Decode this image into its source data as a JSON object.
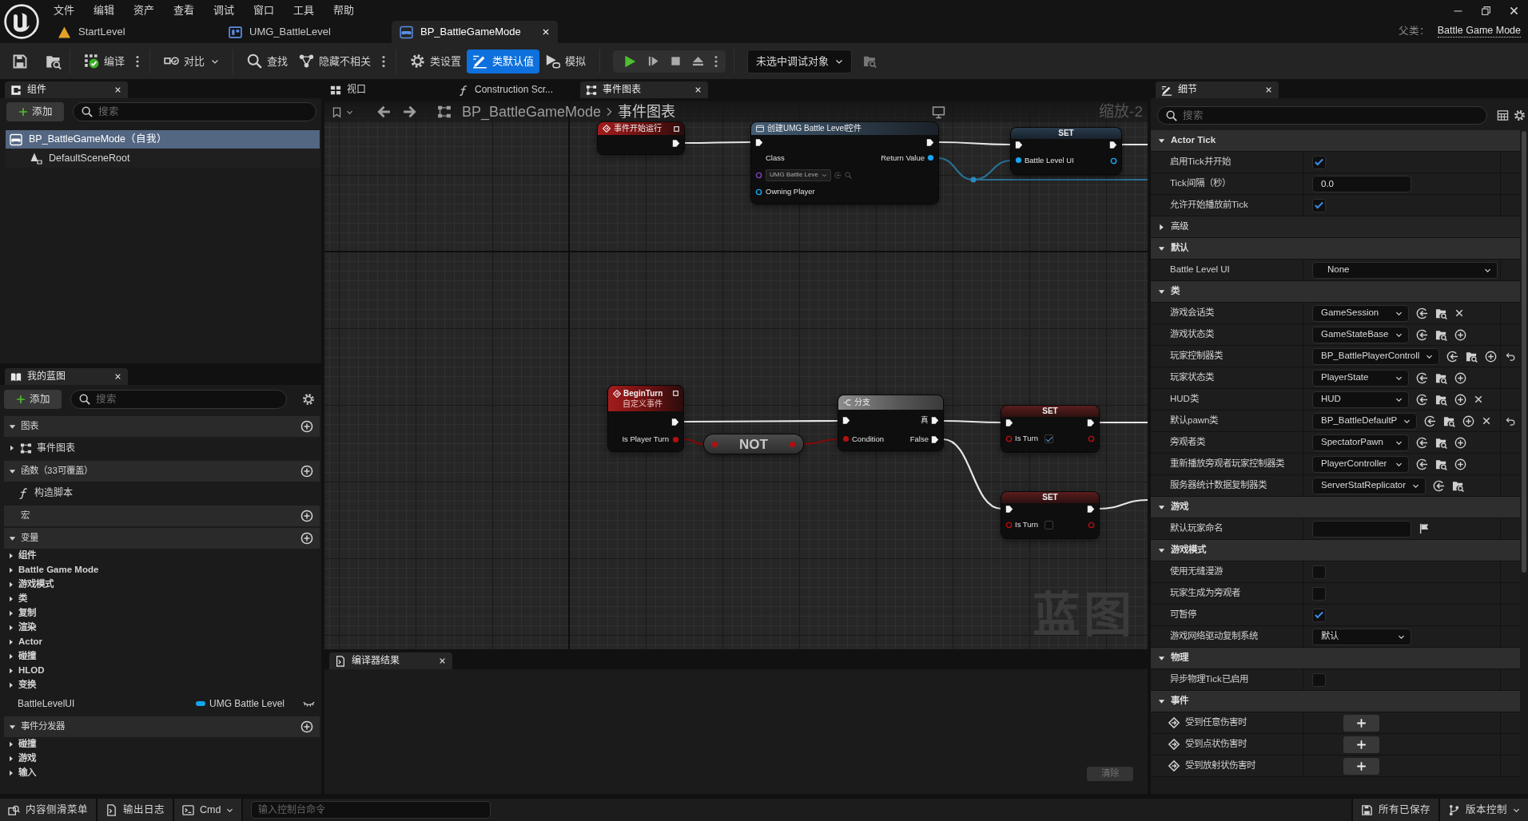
{
  "menu": [
    "文件",
    "编辑",
    "资产",
    "查看",
    "调试",
    "窗口",
    "工具",
    "帮助"
  ],
  "doc_tabs": [
    {
      "label": "StartLevel",
      "kind": "level",
      "selected": false
    },
    {
      "label": "UMG_BattleLevel",
      "kind": "widget",
      "selected": false
    },
    {
      "label": "BP_BattleGameMode",
      "kind": "blueprint",
      "selected": true
    }
  ],
  "parent_class": {
    "label": "父类：",
    "value": "Battle Game Mode"
  },
  "toolbar": {
    "buttons": [
      {
        "kind": "compile",
        "label": "编译",
        "selected": false
      },
      {
        "kind": "diff",
        "label": "对比",
        "selected": false
      },
      {
        "kind": "find",
        "label": "查找",
        "selected": false
      },
      {
        "kind": "hide_unrelated",
        "label": "隐藏不相关",
        "selected": false
      },
      {
        "kind": "class_settings",
        "label": "类设置",
        "selected": false
      },
      {
        "kind": "class_defaults",
        "label": "类默认值",
        "selected": true
      },
      {
        "kind": "simulate",
        "label": "模拟",
        "selected": false
      }
    ],
    "debug_target": "未选中调试对象"
  },
  "components": {
    "tab": "组件",
    "add_button": "添加",
    "search_placeholder": "搜索",
    "tree": [
      {
        "label": "BP_BattleGameMode（自我）",
        "selected": true,
        "children": [
          {
            "label": "DefaultSceneRoot",
            "selected": false
          }
        ]
      }
    ]
  },
  "my_blueprint": {
    "tab": "我的蓝图",
    "add_button": "添加",
    "search_placeholder": "搜索",
    "sections": [
      {
        "title": "图表",
        "expanded": true,
        "items": [
          {
            "kind": "graph",
            "label": "事件图表",
            "expanded": false
          }
        ]
      },
      {
        "title": "函数（33可覆盖）",
        "expanded": true,
        "items": [
          {
            "kind": "function",
            "label": "构造脚本"
          }
        ]
      },
      {
        "title": "宏",
        "expanded": false
      },
      {
        "title": "变量",
        "expanded": true,
        "items": [
          {
            "kind": "category",
            "label": "组件",
            "expanded": false
          },
          {
            "kind": "category",
            "label": "Battle Game Mode",
            "expanded": false
          },
          {
            "kind": "category",
            "label": "游戏模式",
            "expanded": false
          },
          {
            "kind": "category",
            "label": "类",
            "expanded": false
          },
          {
            "kind": "category",
            "label": "复制",
            "expanded": false
          },
          {
            "kind": "category",
            "label": "渲染",
            "expanded": false
          },
          {
            "kind": "category",
            "label": "Actor",
            "expanded": false
          },
          {
            "kind": "category",
            "label": "碰撞",
            "expanded": false
          },
          {
            "kind": "category",
            "label": "HLOD",
            "expanded": false
          },
          {
            "kind": "category",
            "label": "变换",
            "expanded": false
          },
          {
            "kind": "variable",
            "label": "BattleLevelUI",
            "type": "UMG Battle Level"
          }
        ]
      },
      {
        "title": "事件分发器",
        "expanded": true,
        "items": [
          {
            "kind": "category",
            "label": "碰撞",
            "expanded": false
          },
          {
            "kind": "category",
            "label": "游戏",
            "expanded": false
          },
          {
            "kind": "category",
            "label": "输入",
            "expanded": false
          }
        ]
      }
    ]
  },
  "graph": {
    "tabs": [
      {
        "kind": "viewport",
        "label": "视口",
        "selected": false
      },
      {
        "kind": "function",
        "label": "Construction Scr...",
        "selected": false
      },
      {
        "kind": "graph",
        "label": "事件图表",
        "selected": true
      }
    ],
    "breadcrumb": [
      "BP_BattleGameMode",
      "事件图表"
    ],
    "zoom_label": "缩放-2",
    "corner_label": "蓝图",
    "nodes": [
      {
        "kind": "event",
        "title": "事件开始运行"
      },
      {
        "kind": "call",
        "title": "创建UMG Battle Level控件",
        "inputs": [
          {
            "label": "Class",
            "value": "UMG Battle Leve"
          },
          {
            "label": "Owning Player"
          }
        ],
        "output": "Return Value"
      },
      {
        "kind": "set_object",
        "title": "SET",
        "pin": "Battle Level UI"
      },
      {
        "kind": "custom_event",
        "title": "BeginTurn",
        "subtitle": "自定义事件",
        "pin": "Is Player Turn"
      },
      {
        "kind": "not",
        "title": "NOT"
      },
      {
        "kind": "branch",
        "title": "分支",
        "true_label": "真",
        "condition": "Condition",
        "false_label": "False"
      },
      {
        "kind": "set_bool",
        "title": "SET",
        "pin": "Is Turn",
        "checked": true
      },
      {
        "kind": "set_bool",
        "title": "SET",
        "pin": "Is Turn",
        "checked": false
      }
    ]
  },
  "compiler_results": {
    "tab": "编译器结果",
    "clear_button": {
      "label": "清除",
      "disabled": true
    }
  },
  "details": {
    "tab": "细节",
    "search_placeholder": "搜索",
    "sections": [
      {
        "title": "Actor Tick",
        "expanded": true,
        "rows": [
          {
            "kind": "checkbox",
            "label": "启用Tick并开始",
            "checked": true
          },
          {
            "kind": "number",
            "label": "Tick间隔（秒）",
            "value": "0.0"
          },
          {
            "kind": "checkbox",
            "label": "允许开始播放前Tick",
            "checked": true
          },
          {
            "kind": "group",
            "label": "高级",
            "expanded": false
          }
        ]
      },
      {
        "title": "默认",
        "expanded": true,
        "rows": [
          {
            "kind": "object",
            "label": "Battle Level UI",
            "value": "None"
          }
        ]
      },
      {
        "title": "类",
        "expanded": true,
        "rows": [
          {
            "kind": "class",
            "label": "游戏会话类",
            "value": "GameSession",
            "can_create": false,
            "can_clear": true,
            "modified": false
          },
          {
            "kind": "class",
            "label": "游戏状态类",
            "value": "GameStateBase",
            "can_create": true,
            "can_clear": false,
            "modified": false
          },
          {
            "kind": "class",
            "label": "玩家控制器类",
            "value": "BP_BattlePlayerControll",
            "can_create": true,
            "can_clear": false,
            "modified": true
          },
          {
            "kind": "class",
            "label": "玩家状态类",
            "value": "PlayerState",
            "can_create": true,
            "can_clear": false,
            "modified": false
          },
          {
            "kind": "class",
            "label": "HUD类",
            "value": "HUD",
            "can_create": true,
            "can_clear": true,
            "modified": false
          },
          {
            "kind": "class",
            "label": "默认pawn类",
            "value": "BP_BattleDefaultP",
            "can_create": true,
            "can_clear": true,
            "modified": true
          },
          {
            "kind": "class",
            "label": "旁观者类",
            "value": "SpectatorPawn",
            "can_create": true,
            "can_clear": false,
            "modified": false
          },
          {
            "kind": "class",
            "label": "重新播放旁观者玩家控制器类",
            "value": "PlayerController",
            "can_create": true,
            "can_clear": false,
            "modified": false
          },
          {
            "kind": "class",
            "label": "服务器统计数据复制器类",
            "value": "ServerStatReplicator",
            "can_create": false,
            "can_clear": false,
            "modified": false
          }
        ]
      },
      {
        "title": "游戏",
        "expanded": true,
        "rows": [
          {
            "kind": "text",
            "label": "默认玩家命名"
          }
        ]
      },
      {
        "title": "游戏模式",
        "expanded": true,
        "rows": [
          {
            "kind": "checkbox",
            "label": "使用无缝漫游",
            "checked": false
          },
          {
            "kind": "checkbox",
            "label": "玩家生成为旁观者",
            "checked": false
          },
          {
            "kind": "checkbox",
            "label": "可暂停",
            "checked": true
          },
          {
            "kind": "combo",
            "label": "游戏网络驱动复制系统",
            "value": "默认"
          }
        ]
      },
      {
        "title": "物理",
        "expanded": true,
        "rows": [
          {
            "kind": "checkbox",
            "label": "异步物理Tick已启用",
            "checked": false
          }
        ]
      },
      {
        "title": "事件",
        "expanded": true,
        "rows": [
          {
            "kind": "event",
            "label": "受到任意伤害时"
          },
          {
            "kind": "event",
            "label": "受到点状伤害时"
          },
          {
            "kind": "event",
            "label": "受到放射状伤害时"
          }
        ]
      }
    ]
  },
  "status_bar": {
    "left": [
      {
        "kind": "drawer",
        "label": "内容侧滑菜单"
      },
      {
        "kind": "log",
        "label": "输出日志"
      },
      {
        "kind": "cmd",
        "label": "Cmd"
      }
    ],
    "console_placeholder": "输入控制台命令",
    "right": [
      {
        "kind": "saved",
        "label": "所有已保存"
      },
      {
        "kind": "source_control",
        "label": "版本控制"
      }
    ]
  }
}
